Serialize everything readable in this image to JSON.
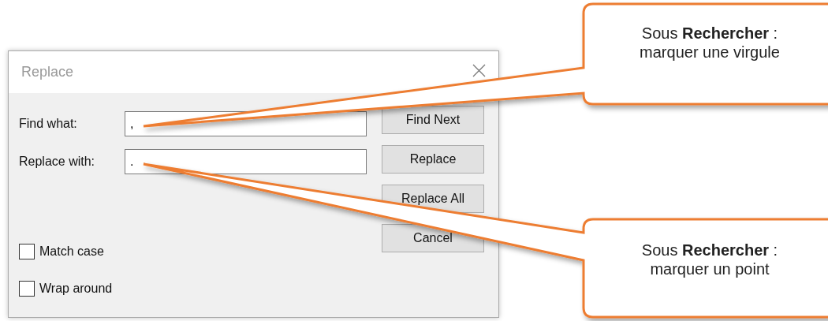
{
  "dialog": {
    "title": "Replace",
    "fields": [
      {
        "label": "Find what:",
        "value": ","
      },
      {
        "label": "Replace with:",
        "value": "."
      }
    ],
    "buttons": [
      "Find Next",
      "Replace",
      "Replace All",
      "Cancel"
    ],
    "checkboxes": [
      {
        "label": "Match case",
        "checked": false
      },
      {
        "label": "Wrap around",
        "checked": false
      }
    ]
  },
  "callouts": [
    {
      "heading": "Sous **Rechercher** :",
      "text": "marquer une virgule"
    },
    {
      "heading": "Sous **Rechercher** :",
      "text": "marquer un point"
    }
  ]
}
